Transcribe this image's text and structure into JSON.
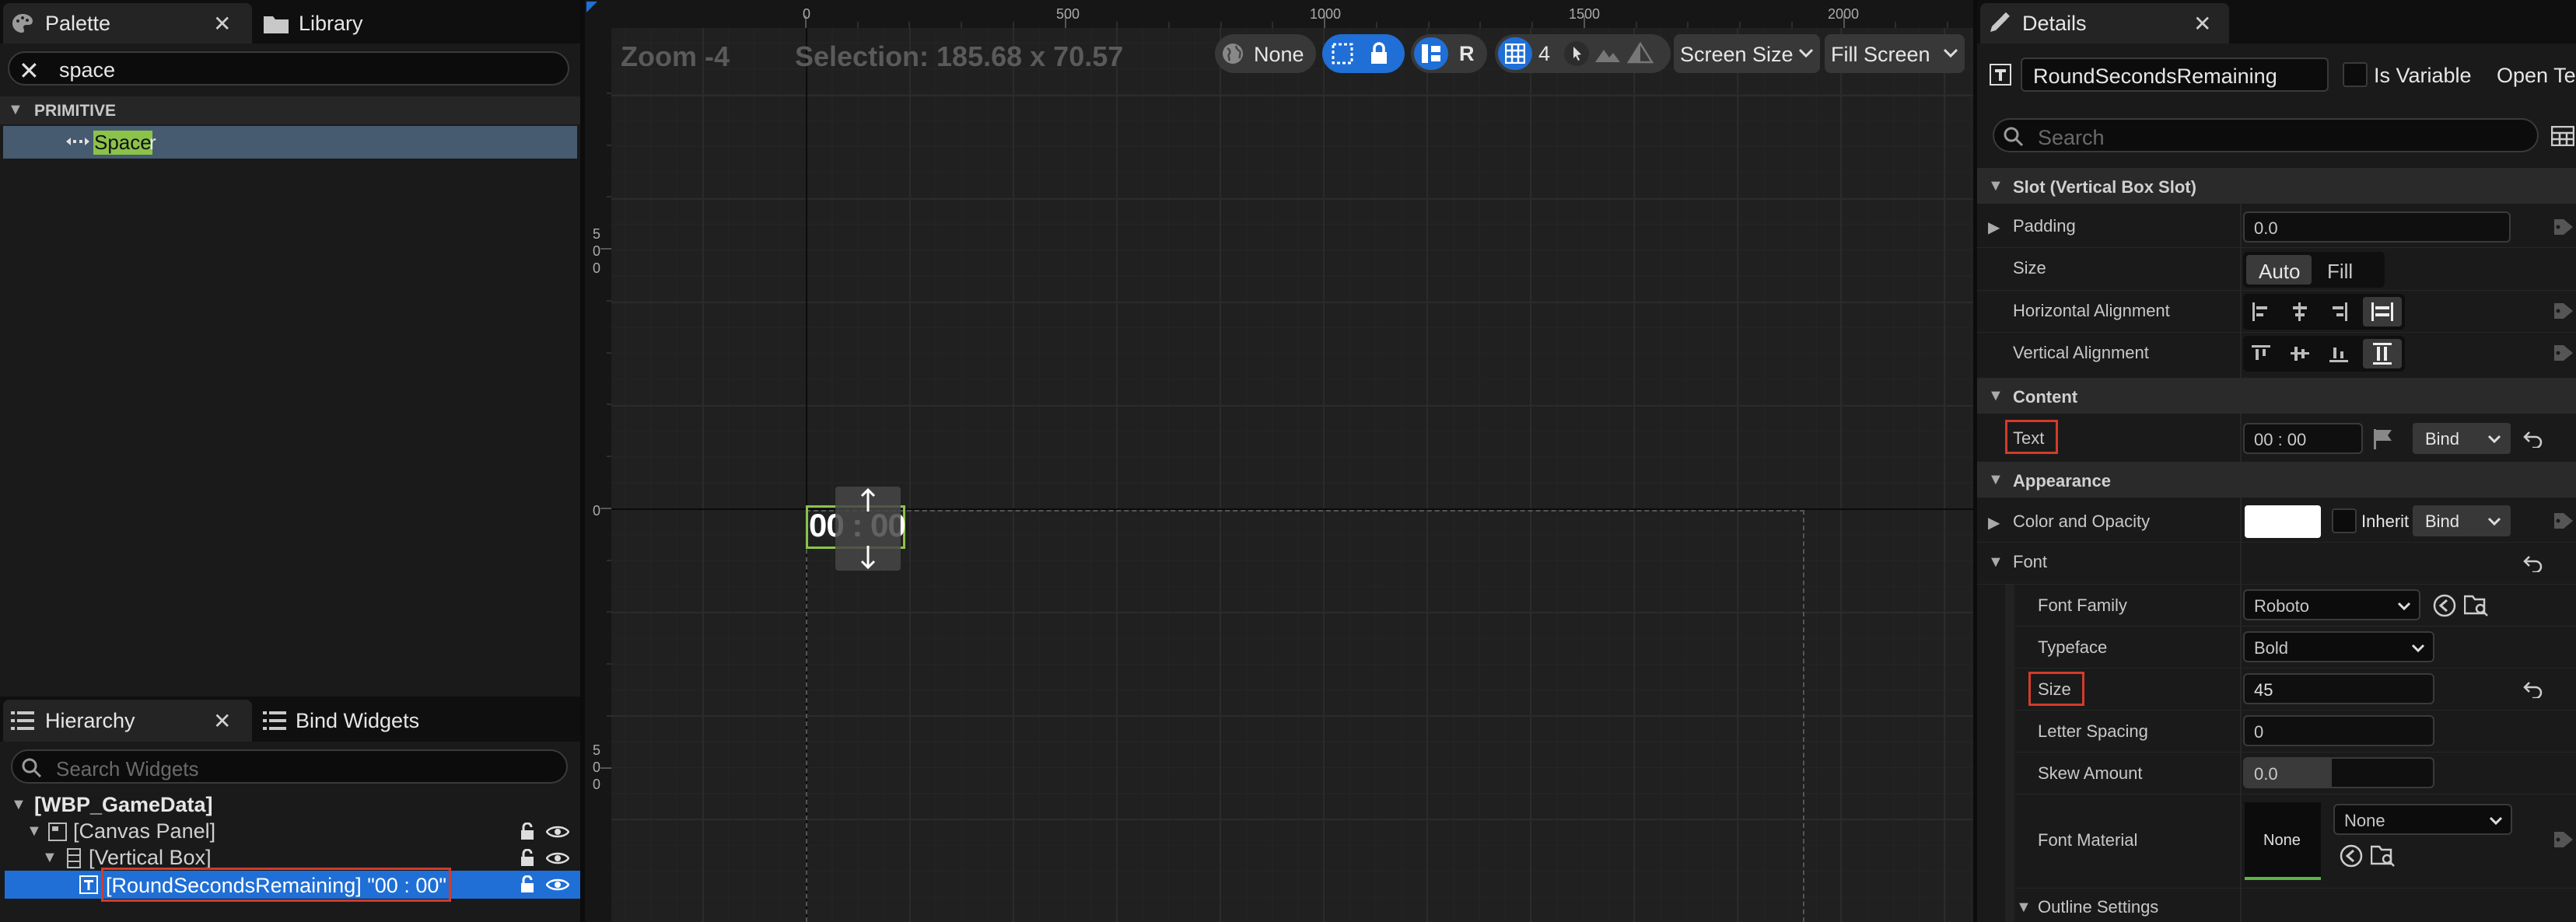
{
  "palette": {
    "tab_label": "Palette",
    "library_label": "Library",
    "search_value": "space",
    "category": "PRIMITIVE",
    "item_match": "Space",
    "item_rest": "r"
  },
  "hierarchy": {
    "tab_label": "Hierarchy",
    "bind_widgets_label": "Bind Widgets",
    "search_placeholder": "Search Widgets",
    "nodes": [
      {
        "label": "[WBP_GameData]"
      },
      {
        "label": "[Canvas Panel]"
      },
      {
        "label": "[Vertical Box]"
      },
      {
        "label": "[RoundSecondsRemaining] \"00 : 00\""
      }
    ]
  },
  "designer": {
    "zoom": "Zoom -4",
    "selection": "Selection: 185.68 x 70.57",
    "ruler_top": [
      "0",
      "500",
      "1000",
      "1500",
      "2000"
    ],
    "ruler_left": [
      "5\n0\n0",
      "0",
      "5\n0\n0"
    ],
    "toolbar": {
      "localization": "None",
      "reflect_r": "R",
      "grid_snap": "4",
      "screen_size": "Screen Size",
      "fill_screen": "Fill Screen"
    },
    "widget_text": "00 : 00"
  },
  "details": {
    "tab_label": "Details",
    "widget_name": "RoundSecondsRemaining",
    "is_variable_label": "Is Variable",
    "open_label": "Open Te",
    "search_placeholder": "Search",
    "sections": {
      "slot": "Slot (Vertical Box Slot)",
      "content": "Content",
      "appearance": "Appearance"
    },
    "padding": {
      "label": "Padding",
      "value": "0.0"
    },
    "size": {
      "label": "Size",
      "auto": "Auto",
      "fill": "Fill"
    },
    "h_align": {
      "label": "Horizontal Alignment"
    },
    "v_align": {
      "label": "Vertical Alignment"
    },
    "text": {
      "label": "Text",
      "value": "00 : 00",
      "bind": "Bind"
    },
    "color": {
      "label": "Color and Opacity",
      "inherit": "Inherit",
      "bind": "Bind"
    },
    "font": {
      "label": "Font",
      "family_label": "Font Family",
      "family": "Roboto",
      "typeface_label": "Typeface",
      "typeface": "Bold",
      "size_label": "Size",
      "size": "45",
      "letter_spacing_label": "Letter Spacing",
      "letter_spacing": "0",
      "skew_label": "Skew Amount",
      "skew": "0.0",
      "material_label": "Font Material",
      "material_thumb": "None",
      "material_value": "None",
      "outline_label": "Outline Settings"
    }
  },
  "colors": {
    "selection_blue": "#1f6fd6",
    "highlight_green": "#8bc34a",
    "annotation_red": "#d33b2a",
    "panel_bg": "#1a1a1a",
    "tab_bg": "#0f0f0f"
  }
}
